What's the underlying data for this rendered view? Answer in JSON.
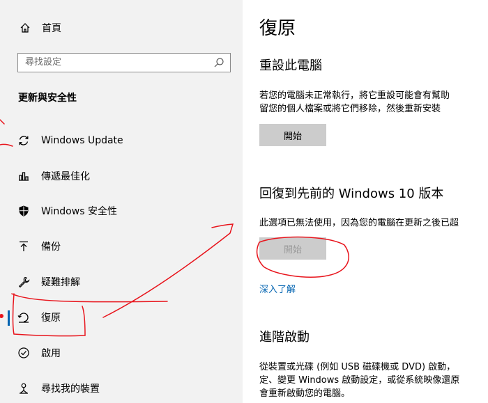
{
  "sidebar": {
    "home_label": "首頁",
    "search_placeholder": "尋找設定",
    "section_title": "更新與安全性",
    "items": [
      {
        "label": "Windows Update",
        "icon": "refresh-icon"
      },
      {
        "label": "傳遞最佳化",
        "icon": "delivery-optimization-icon"
      },
      {
        "label": "Windows 安全性",
        "icon": "shield-icon"
      },
      {
        "label": "備份",
        "icon": "backup-arrow-icon"
      },
      {
        "label": "疑難排解",
        "icon": "wrench-icon"
      },
      {
        "label": "復原",
        "icon": "recovery-icon",
        "active": true
      },
      {
        "label": "啟用",
        "icon": "check-circle-icon"
      },
      {
        "label": "尋找我的裝置",
        "icon": "find-device-icon"
      }
    ]
  },
  "main": {
    "title": "復原",
    "reset": {
      "heading": "重設此電腦",
      "line1": "若您的電腦未正常執行，將它重設可能會有幫助",
      "line2": "留您的個人檔案或將它們移除，然後重新安裝",
      "button": "開始"
    },
    "rollback": {
      "heading": "回復到先前的 Windows 10 版本",
      "line1": "此選項已無法使用，因為您的電腦在更新之後已超",
      "button": "開始",
      "link": "深入了解"
    },
    "advanced": {
      "heading": "進階啟動",
      "line1": "從裝置或光碟 (例如 USB 磁碟機或 DVD) 啟動，",
      "line2": "定、變更 Windows 啟動設定，或從系統映像還原",
      "line3": "會重新啟動您的電腦。"
    }
  },
  "colors": {
    "sidebar_bg": "#f2f2f2",
    "accent": "#0063b1",
    "button_bg": "#cccccc",
    "annotation_red": "#e8141c"
  }
}
